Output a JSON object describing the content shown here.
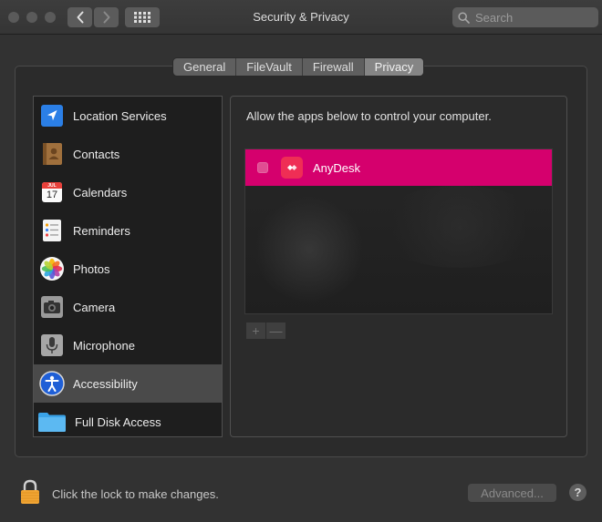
{
  "window": {
    "title": "Security & Privacy"
  },
  "search": {
    "placeholder": "Search"
  },
  "tabs": [
    {
      "label": "General"
    },
    {
      "label": "FileVault"
    },
    {
      "label": "Firewall"
    },
    {
      "label": "Privacy",
      "active": true
    }
  ],
  "sidebar": {
    "items": [
      {
        "label": "Location Services",
        "icon": "location-arrow-icon"
      },
      {
        "label": "Contacts",
        "icon": "contacts-book-icon"
      },
      {
        "label": "Calendars",
        "icon": "calendar-icon",
        "icon_month": "JUL",
        "icon_day": "17"
      },
      {
        "label": "Reminders",
        "icon": "reminders-list-icon"
      },
      {
        "label": "Photos",
        "icon": "photos-flower-icon"
      },
      {
        "label": "Camera",
        "icon": "camera-icon"
      },
      {
        "label": "Microphone",
        "icon": "microphone-icon"
      },
      {
        "label": "Accessibility",
        "icon": "accessibility-icon",
        "active": true
      },
      {
        "label": "Full Disk Access",
        "icon": "folder-icon"
      }
    ]
  },
  "content": {
    "description": "Allow the apps below to control your computer.",
    "apps": [
      {
        "name": "AnyDesk",
        "checked": false,
        "selected": true,
        "icon": "anydesk-icon"
      }
    ],
    "add_label": "+",
    "remove_label": "—"
  },
  "footer": {
    "lock_text": "Click the lock to make changes.",
    "advanced_label": "Advanced...",
    "help_label": "?"
  },
  "colors": {
    "selection": "#d5006d",
    "anydesk": "#ef2e55",
    "accessibility": "#1f5fd6",
    "lock": "#f1a534"
  }
}
